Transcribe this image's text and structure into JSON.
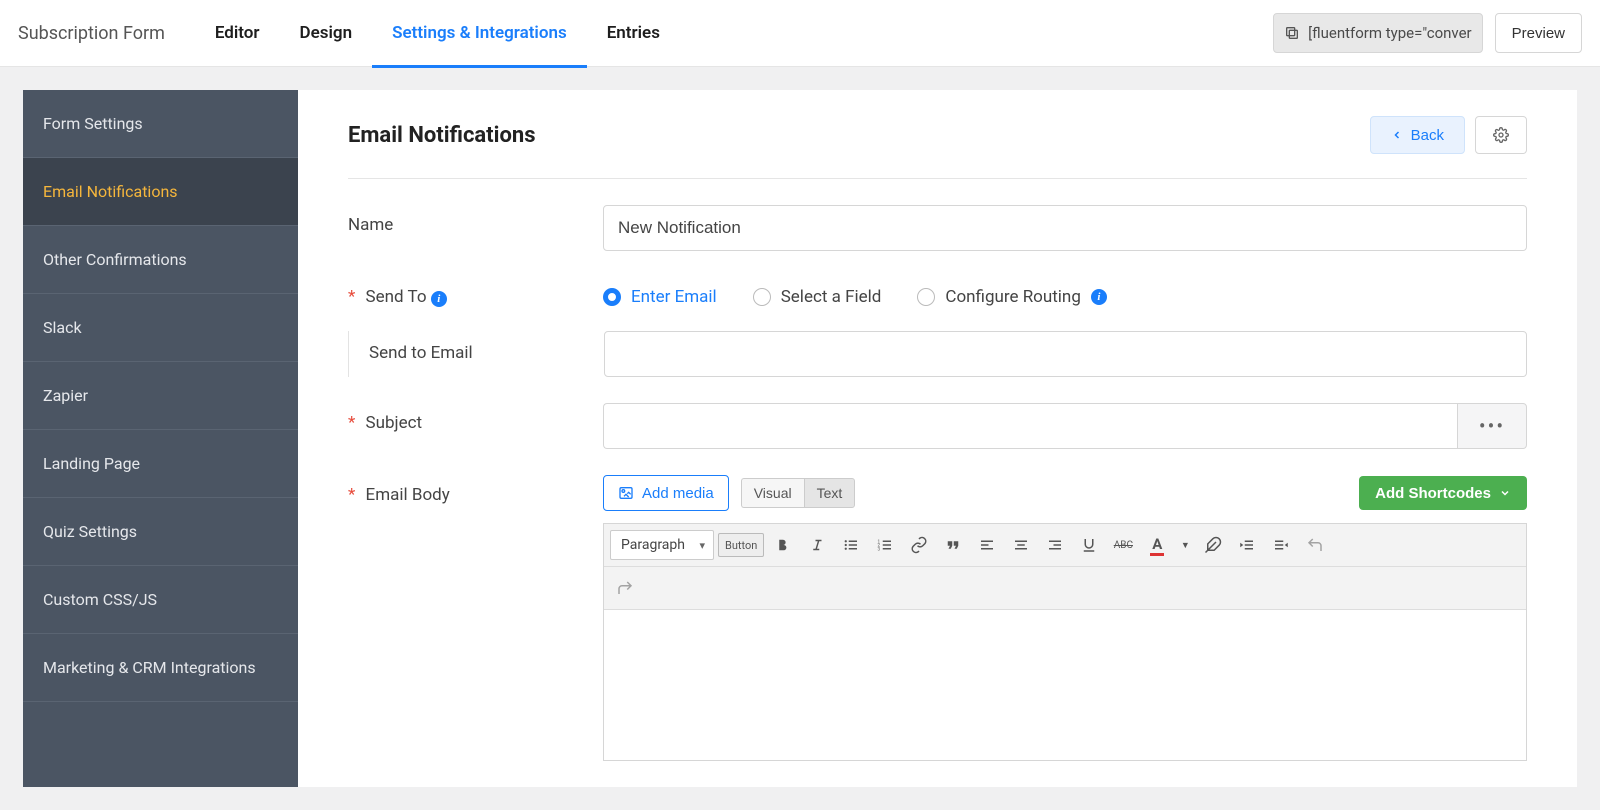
{
  "topbar": {
    "form_title": "Subscription Form",
    "nav": [
      "Editor",
      "Design",
      "Settings & Integrations",
      "Entries"
    ],
    "nav_active_index": 2,
    "shortcode": "[fluentform type=\"conver",
    "preview": "Preview"
  },
  "sidebar": {
    "items": [
      "Form Settings",
      "Email Notifications",
      "Other Confirmations",
      "Slack",
      "Zapier",
      "Landing Page",
      "Quiz Settings",
      "Custom CSS/JS",
      "Marketing & CRM Integrations"
    ],
    "active_index": 1
  },
  "page": {
    "title": "Email Notifications",
    "back_label": "Back"
  },
  "fields": {
    "name": {
      "label": "Name",
      "value": "New Notification"
    },
    "sendto": {
      "label": "Send To",
      "options": [
        "Enter Email",
        "Select a Field",
        "Configure Routing"
      ],
      "selected_index": 0,
      "sub_label": "Send to Email",
      "sub_value": ""
    },
    "subject": {
      "label": "Subject",
      "value": ""
    },
    "body": {
      "label": "Email Body",
      "add_media": "Add media",
      "tabs": [
        "Visual",
        "Text"
      ],
      "tab_active_index": 1,
      "shortcodes_btn": "Add Shortcodes",
      "format_select": "Paragraph",
      "button_pill": "Button"
    }
  }
}
